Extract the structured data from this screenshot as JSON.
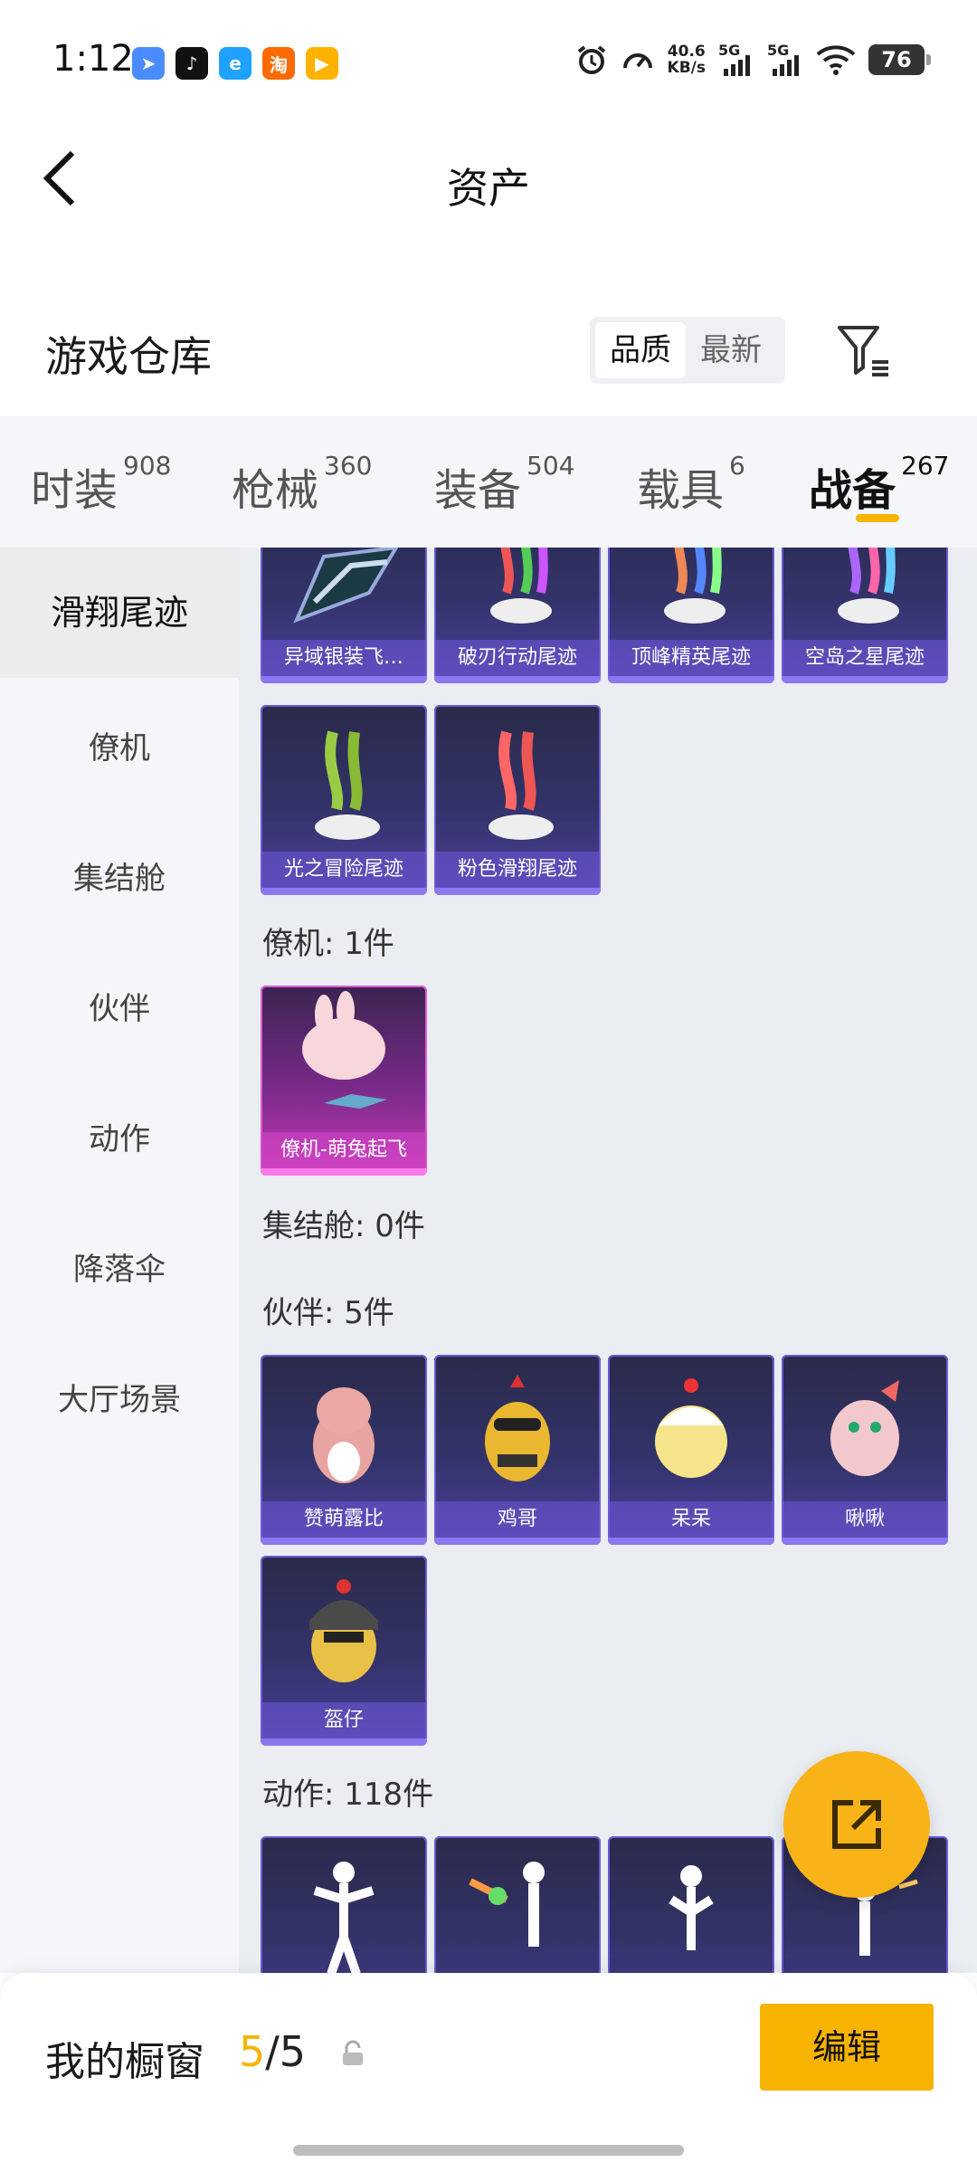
{
  "status_bar": {
    "time": "1:12",
    "speed_value": "40.6",
    "speed_unit": "KB/s",
    "net1": "5G",
    "net2": "5G",
    "battery": "76"
  },
  "header": {
    "title": "资产"
  },
  "warehouse": {
    "title": "游戏仓库",
    "sort_options": [
      "品质",
      "最新"
    ],
    "active_sort": "品质"
  },
  "tabs": [
    {
      "label": "时装",
      "count": "908"
    },
    {
      "label": "枪械",
      "count": "360"
    },
    {
      "label": "装备",
      "count": "504"
    },
    {
      "label": "载具",
      "count": "6"
    },
    {
      "label": "战备",
      "count": "267",
      "active": true
    }
  ],
  "sidebar": {
    "items": [
      "滑翔尾迹",
      "僚机",
      "集结舱",
      "伙伴",
      "动作",
      "降落伞",
      "大厅场景"
    ],
    "active": "滑翔尾迹"
  },
  "sections": {
    "trails": {
      "items": [
        "异域银装飞…",
        "破刃行动尾迹",
        "顶峰精英尾迹",
        "空岛之星尾迹",
        "光之冒险尾迹",
        "粉色滑翔尾迹"
      ]
    },
    "wingman": {
      "header": "僚机: 1件",
      "items": [
        "僚机-萌兔起飞"
      ]
    },
    "capsule": {
      "header": "集结舱: 0件"
    },
    "partner": {
      "header": "伙伴: 5件",
      "items": [
        "赞萌露比",
        "鸡哥",
        "呆呆",
        "啾啾",
        "盔仔"
      ]
    },
    "emote": {
      "header": "动作: 118件"
    }
  },
  "bottom_bar": {
    "label": "我的橱窗",
    "current": "5",
    "sep_total": "/5",
    "edit_label": "编辑"
  },
  "colors": {
    "accent": "#f8b300",
    "card_purple": "#33336a",
    "card_pink": "#c83ab8"
  }
}
